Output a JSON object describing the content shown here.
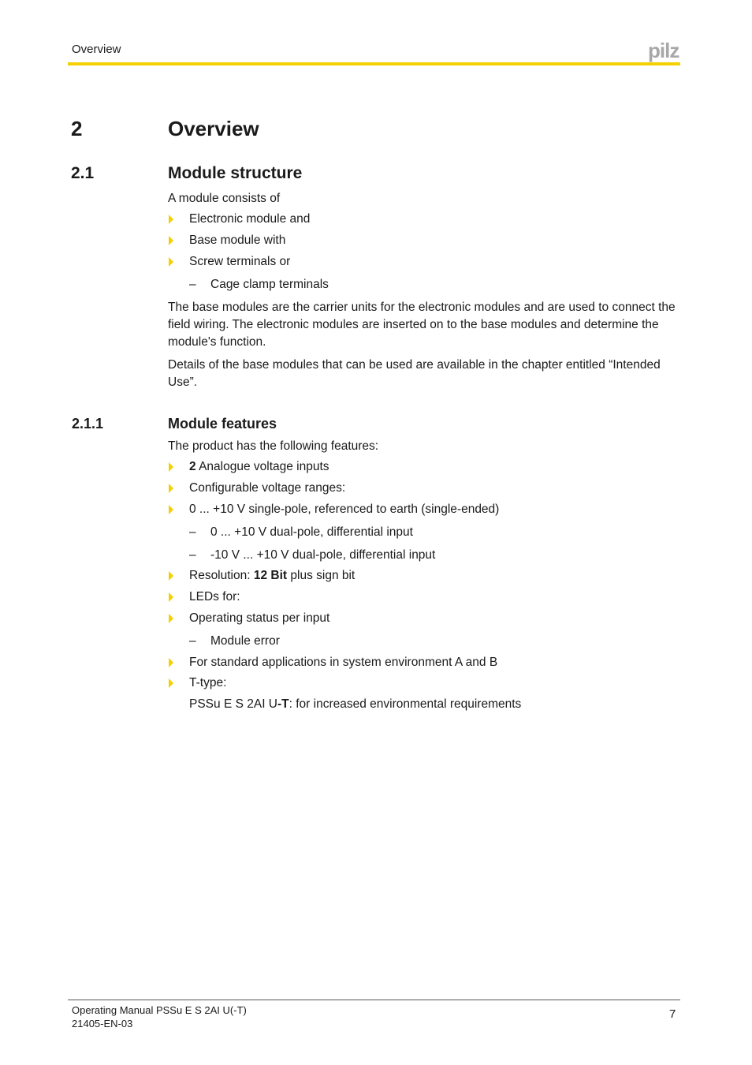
{
  "header": {
    "section_label": "Overview",
    "logo_text": "pilz",
    "accent_color": "#f5d000"
  },
  "chapter": {
    "number": "2",
    "title": "Overview"
  },
  "section": {
    "number": "2.1",
    "title": "Module structure",
    "intro": "A module consists of",
    "bullets": [
      "Electronic module and",
      "Base module with",
      "Screw terminals or"
    ],
    "sub_bullets": [
      "Cage clamp terminals"
    ],
    "paragraphs": [
      "The base modules are the carrier units for the electronic modules and are used to connect the field wiring. The electronic modules are inserted on to the base modules and determine the module's function.",
      "Details of the base modules that can be used are available in the chapter entitled “Intended Use”."
    ]
  },
  "subsection": {
    "number": "2.1.1",
    "title": "Module features",
    "intro": "The product has the following features:",
    "items": [
      {
        "type": "bullet",
        "bold": "2",
        "text": " Analogue voltage inputs"
      },
      {
        "type": "bullet",
        "text": "Configurable voltage ranges:"
      },
      {
        "type": "bullet",
        "text": "0 ... +10 V single-pole, referenced to earth (single-ended)"
      },
      {
        "type": "dash",
        "text": "0 ... +10 V dual-pole, differential input"
      },
      {
        "type": "dash",
        "text": "-10 V ... +10 V dual-pole, differential input"
      },
      {
        "type": "bullet",
        "pre": "Resolution: ",
        "bold": "12 Bit",
        "post": " plus sign bit"
      },
      {
        "type": "bullet",
        "text": "LEDs for:"
      },
      {
        "type": "bullet",
        "text": "Operating status per input"
      },
      {
        "type": "dash",
        "text": "Module error"
      },
      {
        "type": "bullet",
        "text": "For standard applications in system environment A and B"
      },
      {
        "type": "bullet",
        "text": "T-type:"
      },
      {
        "type": "continuation",
        "pre": "PSSu E S 2AI U",
        "bold": "-T",
        "post": ": for increased environmental requirements"
      }
    ]
  },
  "footer": {
    "title": "Operating Manual PSSu E S 2AI U(-T)",
    "doc_number": "21405-EN-03",
    "page_number": "7"
  },
  "glyphs": {
    "dash": "–"
  }
}
